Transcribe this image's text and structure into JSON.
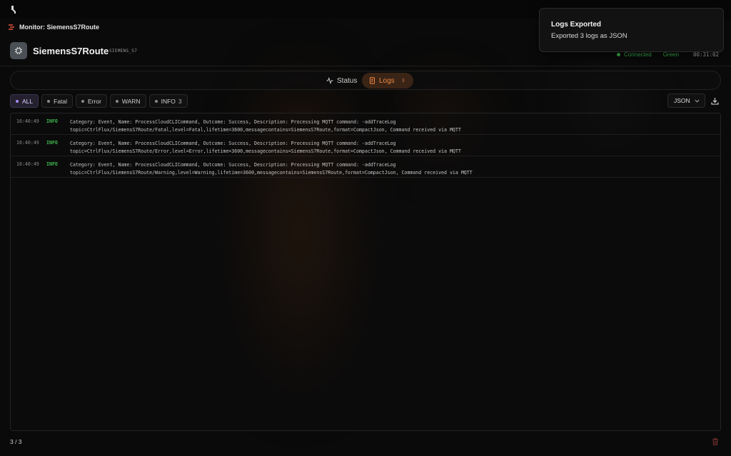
{
  "topbar": {
    "icon": "app-logo-icon"
  },
  "monitor": {
    "title": "Monitor: SiemensS7Route",
    "icon": "monitor-icon"
  },
  "device": {
    "name": "SiemensS7Route",
    "tag": "SIEMENS_S7",
    "icon": "chip-icon"
  },
  "status": {
    "connection": "Connected",
    "health": "Green",
    "uptime": "00:31:02",
    "color": "#3fb950"
  },
  "tabs": {
    "status": {
      "label": "Status",
      "icon": "activity-icon"
    },
    "logs": {
      "label": "Logs",
      "icon": "scroll-icon",
      "badge": "3",
      "active": true
    }
  },
  "filters": [
    {
      "label": "ALL",
      "dot": "#a78bfa",
      "active": true,
      "count": ""
    },
    {
      "label": "Fatal",
      "dot": "#8a8a8a",
      "active": false,
      "count": ""
    },
    {
      "label": "Error",
      "dot": "#8a8a8a",
      "active": false,
      "count": ""
    },
    {
      "label": "WARN",
      "dot": "#8a8a8a",
      "active": false,
      "count": ""
    },
    {
      "label": "INFO",
      "dot": "#8a8a8a",
      "active": false,
      "count": "3"
    }
  ],
  "export": {
    "format": "JSON",
    "download_icon": "download-icon"
  },
  "logs": [
    {
      "time": "16:40:49",
      "level": "INFO",
      "line1": "Category: Event, Name: ProcessCloudCLICommand, Outcome: Success, Description: Processing MQTT command: -addTraceLog",
      "line2": "topic=CtrlFlux/SiemensS7Route/Fatal,level=Fatal,lifetime=3600,messagecontains=SiemensS7Route,format=CompactJson, Command received via MQTT"
    },
    {
      "time": "16:40:49",
      "level": "INFO",
      "line1": "Category: Event, Name: ProcessCloudCLICommand, Outcome: Success, Description: Processing MQTT command: -addTraceLog",
      "line2": "topic=CtrlFlux/SiemensS7Route/Error,level=Error,lifetime=3600,messagecontains=SiemensS7Route,format=CompactJson, Command received via MQTT"
    },
    {
      "time": "16:40:49",
      "level": "INFO",
      "line1": "Category: Event, Name: ProcessCloudCLICommand, Outcome: Success, Description: Processing MQTT command: -addTraceLog",
      "line2": "topic=CtrlFlux/SiemensS7Route/Warning,level=Warning,lifetime=3600,messagecontains=SiemensS7Route,format=CompactJson, Command received via MQTT"
    }
  ],
  "footer": {
    "count": "3 / 3",
    "trash_icon": "trash-icon"
  },
  "toast": {
    "title": "Logs Exported",
    "body": "Exported 3 logs as JSON"
  }
}
